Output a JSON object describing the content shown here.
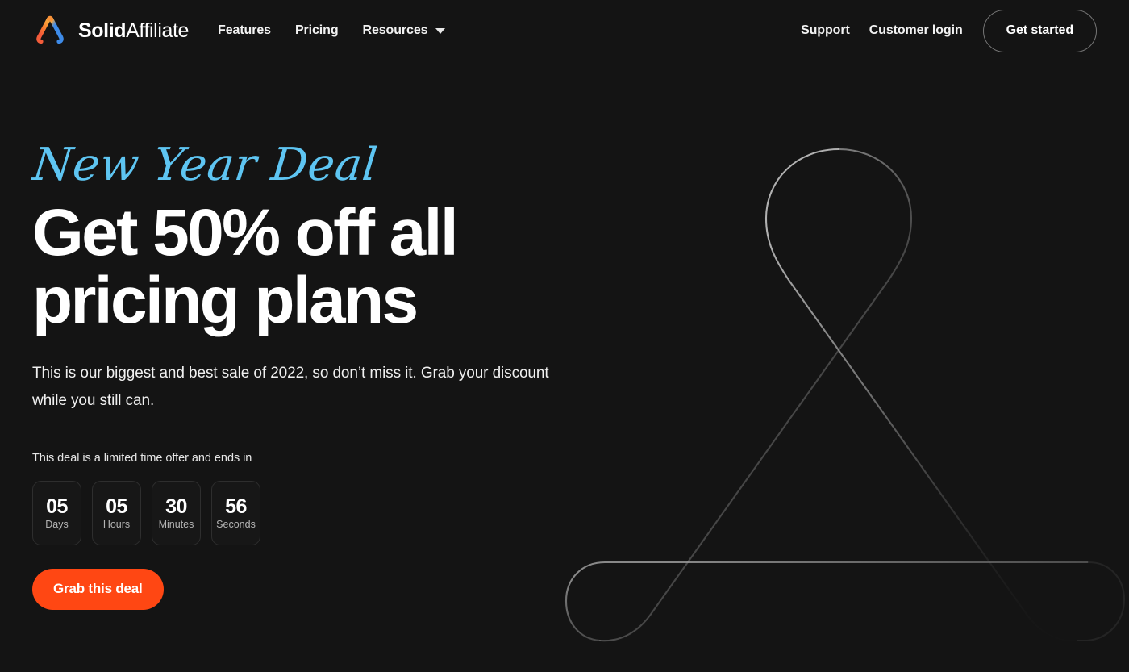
{
  "theme": {
    "background": "#141414",
    "accent_orange": "#FF4713",
    "accent_blue": "#5EC5F2",
    "text_primary": "#FFFFFF",
    "text_muted": "#B4B4B4",
    "border_subtle": "#2E2E2E",
    "border_button": "#757575"
  },
  "header": {
    "brand": {
      "icon": "solid-affiliate-triangle-logo",
      "name_bold": "Solid",
      "name_light": "Affiliate"
    },
    "nav": [
      {
        "label": "Features",
        "has_dropdown": false
      },
      {
        "label": "Pricing",
        "has_dropdown": false
      },
      {
        "label": "Resources",
        "has_dropdown": true,
        "icon": "chevron-down-icon"
      }
    ],
    "right": {
      "support_label": "Support",
      "login_label": "Customer login",
      "cta_label": "Get started"
    }
  },
  "hero": {
    "eyebrow": "New Year Deal",
    "title_line_1": "Get 50% off all",
    "title_line_2": "pricing plans",
    "subtitle": "This is our biggest and best sale of 2022, so don’t miss it. Grab your discount while you still can.",
    "countdown_label": "This deal is a limited time offer and ends in",
    "countdown": [
      {
        "value": "05",
        "unit": "Days"
      },
      {
        "value": "05",
        "unit": "Hours"
      },
      {
        "value": "30",
        "unit": "Minutes"
      },
      {
        "value": "56",
        "unit": "Seconds"
      }
    ],
    "cta_label": "Grab this deal"
  },
  "decoration": {
    "name": "large-outlined-triangle-mark"
  }
}
